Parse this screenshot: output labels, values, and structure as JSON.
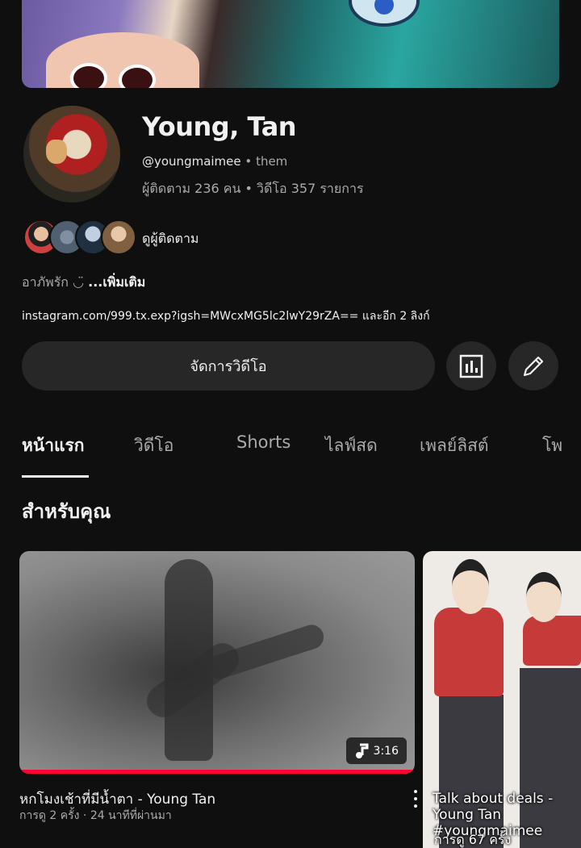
{
  "channel": {
    "name": "Young, Tan",
    "handle": "@youngmaimee",
    "pronoun_sep": "•",
    "pronoun": "them",
    "stats": "ผู้ติดตาม 236 คน • วิดีโอ 357 รายการ",
    "subscribers_label": "ดูผู้ติดตาม",
    "bio": "อาภัพรัก ◡̈ ",
    "bio_more": "...เพิ่มเติม",
    "link": "instagram.com/999.tx.exp?igsh=MWcxMG5lc2lwY29rZA== และอีก 2 ลิงก์"
  },
  "actions": {
    "manage_videos": "จัดการวิดีโอ",
    "analytics_icon": "bar-chart-icon",
    "edit_icon": "pencil-icon"
  },
  "tabs": [
    {
      "label": "หน้าแรก"
    },
    {
      "label": "วิดีโอ"
    },
    {
      "label": "Shorts"
    },
    {
      "label": "ไลฟ์สด"
    },
    {
      "label": "เพลย์ลิสต์"
    },
    {
      "label": "โพ"
    }
  ],
  "section": {
    "title": "สำหรับคุณ"
  },
  "video": {
    "duration": "3:16",
    "title": "หกโมงเช้าที่มีน้ำตา - Young Tan",
    "meta": "การดู 2 ครั้ง · 24 นาทีที่ผ่านมา",
    "watch_progress": 1.0
  },
  "short": {
    "caption": "Talk about deals - Young Tan #youngmaimee",
    "views": "การดู 67 ครั้ง"
  },
  "colors": {
    "background": "#0f0f0f",
    "surface": "#272727",
    "accent": "#ff0033"
  }
}
